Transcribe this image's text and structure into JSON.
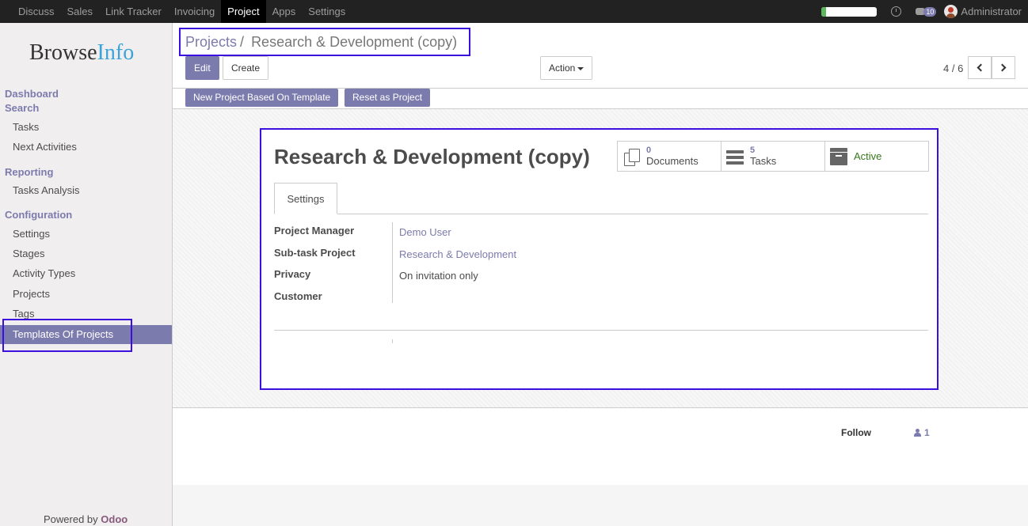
{
  "topbar": {
    "menu": [
      "Discuss",
      "Sales",
      "Link Tracker",
      "Invoicing",
      "Project",
      "Apps",
      "Settings"
    ],
    "active_menu": "Project",
    "progress_level": 0.08,
    "progress_color": "#5cb85c",
    "chat_badge": "10",
    "user_name": "Administrator",
    "icons": [
      "clock-icon",
      "chat-icon",
      "avatar"
    ]
  },
  "sidebar": {
    "logo_part1": "Browse",
    "logo_part2": "Info",
    "sections": {
      "dashboard": "Dashboard",
      "search": "Search",
      "reporting": "Reporting",
      "configuration": "Configuration"
    },
    "search_items": [
      "Tasks",
      "Next Activities"
    ],
    "reporting_items": [
      "Tasks Analysis"
    ],
    "config_items": [
      "Settings",
      "Stages",
      "Activity Types",
      "Projects",
      "Tags",
      "Templates Of Projects"
    ],
    "active_item": "Templates Of Projects",
    "powered_by": "Powered by",
    "powered_brand": "Odoo"
  },
  "control_panel": {
    "breadcrumb_parent": "Projects",
    "breadcrumb_sep": "/",
    "breadcrumb_current": "Research & Development (copy)",
    "edit_label": "Edit",
    "create_label": "Create",
    "action_label": "Action",
    "pager": "4 / 6"
  },
  "header_buttons": {
    "new_from_template": "New Project Based On Template",
    "reset_as_project": "Reset as Project"
  },
  "form": {
    "title": "Research & Development (copy)",
    "stats": {
      "documents_count": "0",
      "documents_label": "Documents",
      "tasks_count": "5",
      "tasks_label": "Tasks",
      "active_label": "Active"
    },
    "tab_label": "Settings",
    "fields": {
      "project_manager_label": "Project Manager",
      "project_manager_value": "Demo User",
      "subtask_label": "Sub-task Project",
      "subtask_value": "Research & Development",
      "privacy_label": "Privacy",
      "privacy_value": "On invitation only",
      "customer_label": "Customer",
      "customer_value": ""
    }
  },
  "chatter": {
    "follow_label": "Follow",
    "followers_count": "1"
  },
  "colors": {
    "brand": "#7c7bad",
    "highlight": "#3a0fe0",
    "topbar": "#222222"
  }
}
